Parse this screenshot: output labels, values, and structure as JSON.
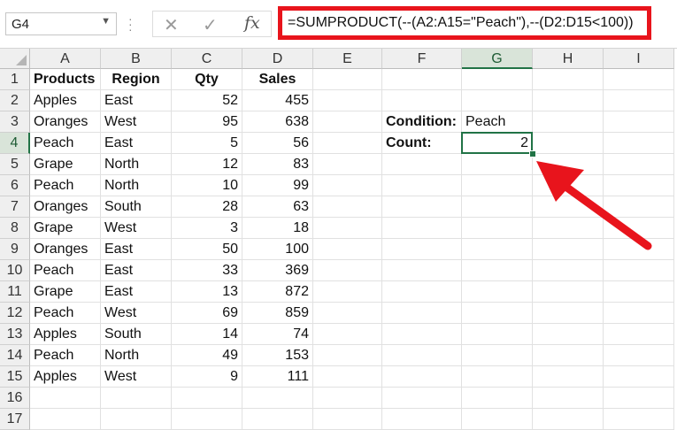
{
  "name_box": {
    "value": "G4"
  },
  "formula_bar": {
    "cancel_icon": "close-icon",
    "enter_icon": "check-icon",
    "fx_label": "fx",
    "formula": "=SUMPRODUCT(--(A2:A15=\"Peach\"),--(D2:D15<100))"
  },
  "columns": [
    "A",
    "B",
    "C",
    "D",
    "E",
    "F",
    "G",
    "H",
    "I"
  ],
  "rows": [
    "1",
    "2",
    "3",
    "4",
    "5",
    "6",
    "7",
    "8",
    "9",
    "10",
    "11",
    "12",
    "13",
    "14",
    "15",
    "16",
    "17"
  ],
  "selected_cell": "G4",
  "table": {
    "headers": [
      "Products",
      "Region",
      "Qty",
      "Sales"
    ],
    "rows": [
      [
        "Apples",
        "East",
        "52",
        "455"
      ],
      [
        "Oranges",
        "West",
        "95",
        "638"
      ],
      [
        "Peach",
        "East",
        "5",
        "56"
      ],
      [
        "Grape",
        "North",
        "12",
        "83"
      ],
      [
        "Peach",
        "North",
        "10",
        "99"
      ],
      [
        "Oranges",
        "South",
        "28",
        "63"
      ],
      [
        "Grape",
        "West",
        "3",
        "18"
      ],
      [
        "Oranges",
        "East",
        "50",
        "100"
      ],
      [
        "Peach",
        "East",
        "33",
        "369"
      ],
      [
        "Grape",
        "East",
        "13",
        "872"
      ],
      [
        "Peach",
        "West",
        "69",
        "859"
      ],
      [
        "Apples",
        "South",
        "14",
        "74"
      ],
      [
        "Peach",
        "North",
        "49",
        "153"
      ],
      [
        "Apples",
        "West",
        "9",
        "111"
      ]
    ]
  },
  "side": {
    "condition_label": "Condition:",
    "condition_value": "Peach",
    "count_label": "Count:",
    "count_value": "2"
  },
  "colors": {
    "highlight_red": "#e8141c",
    "excel_green": "#217346"
  }
}
